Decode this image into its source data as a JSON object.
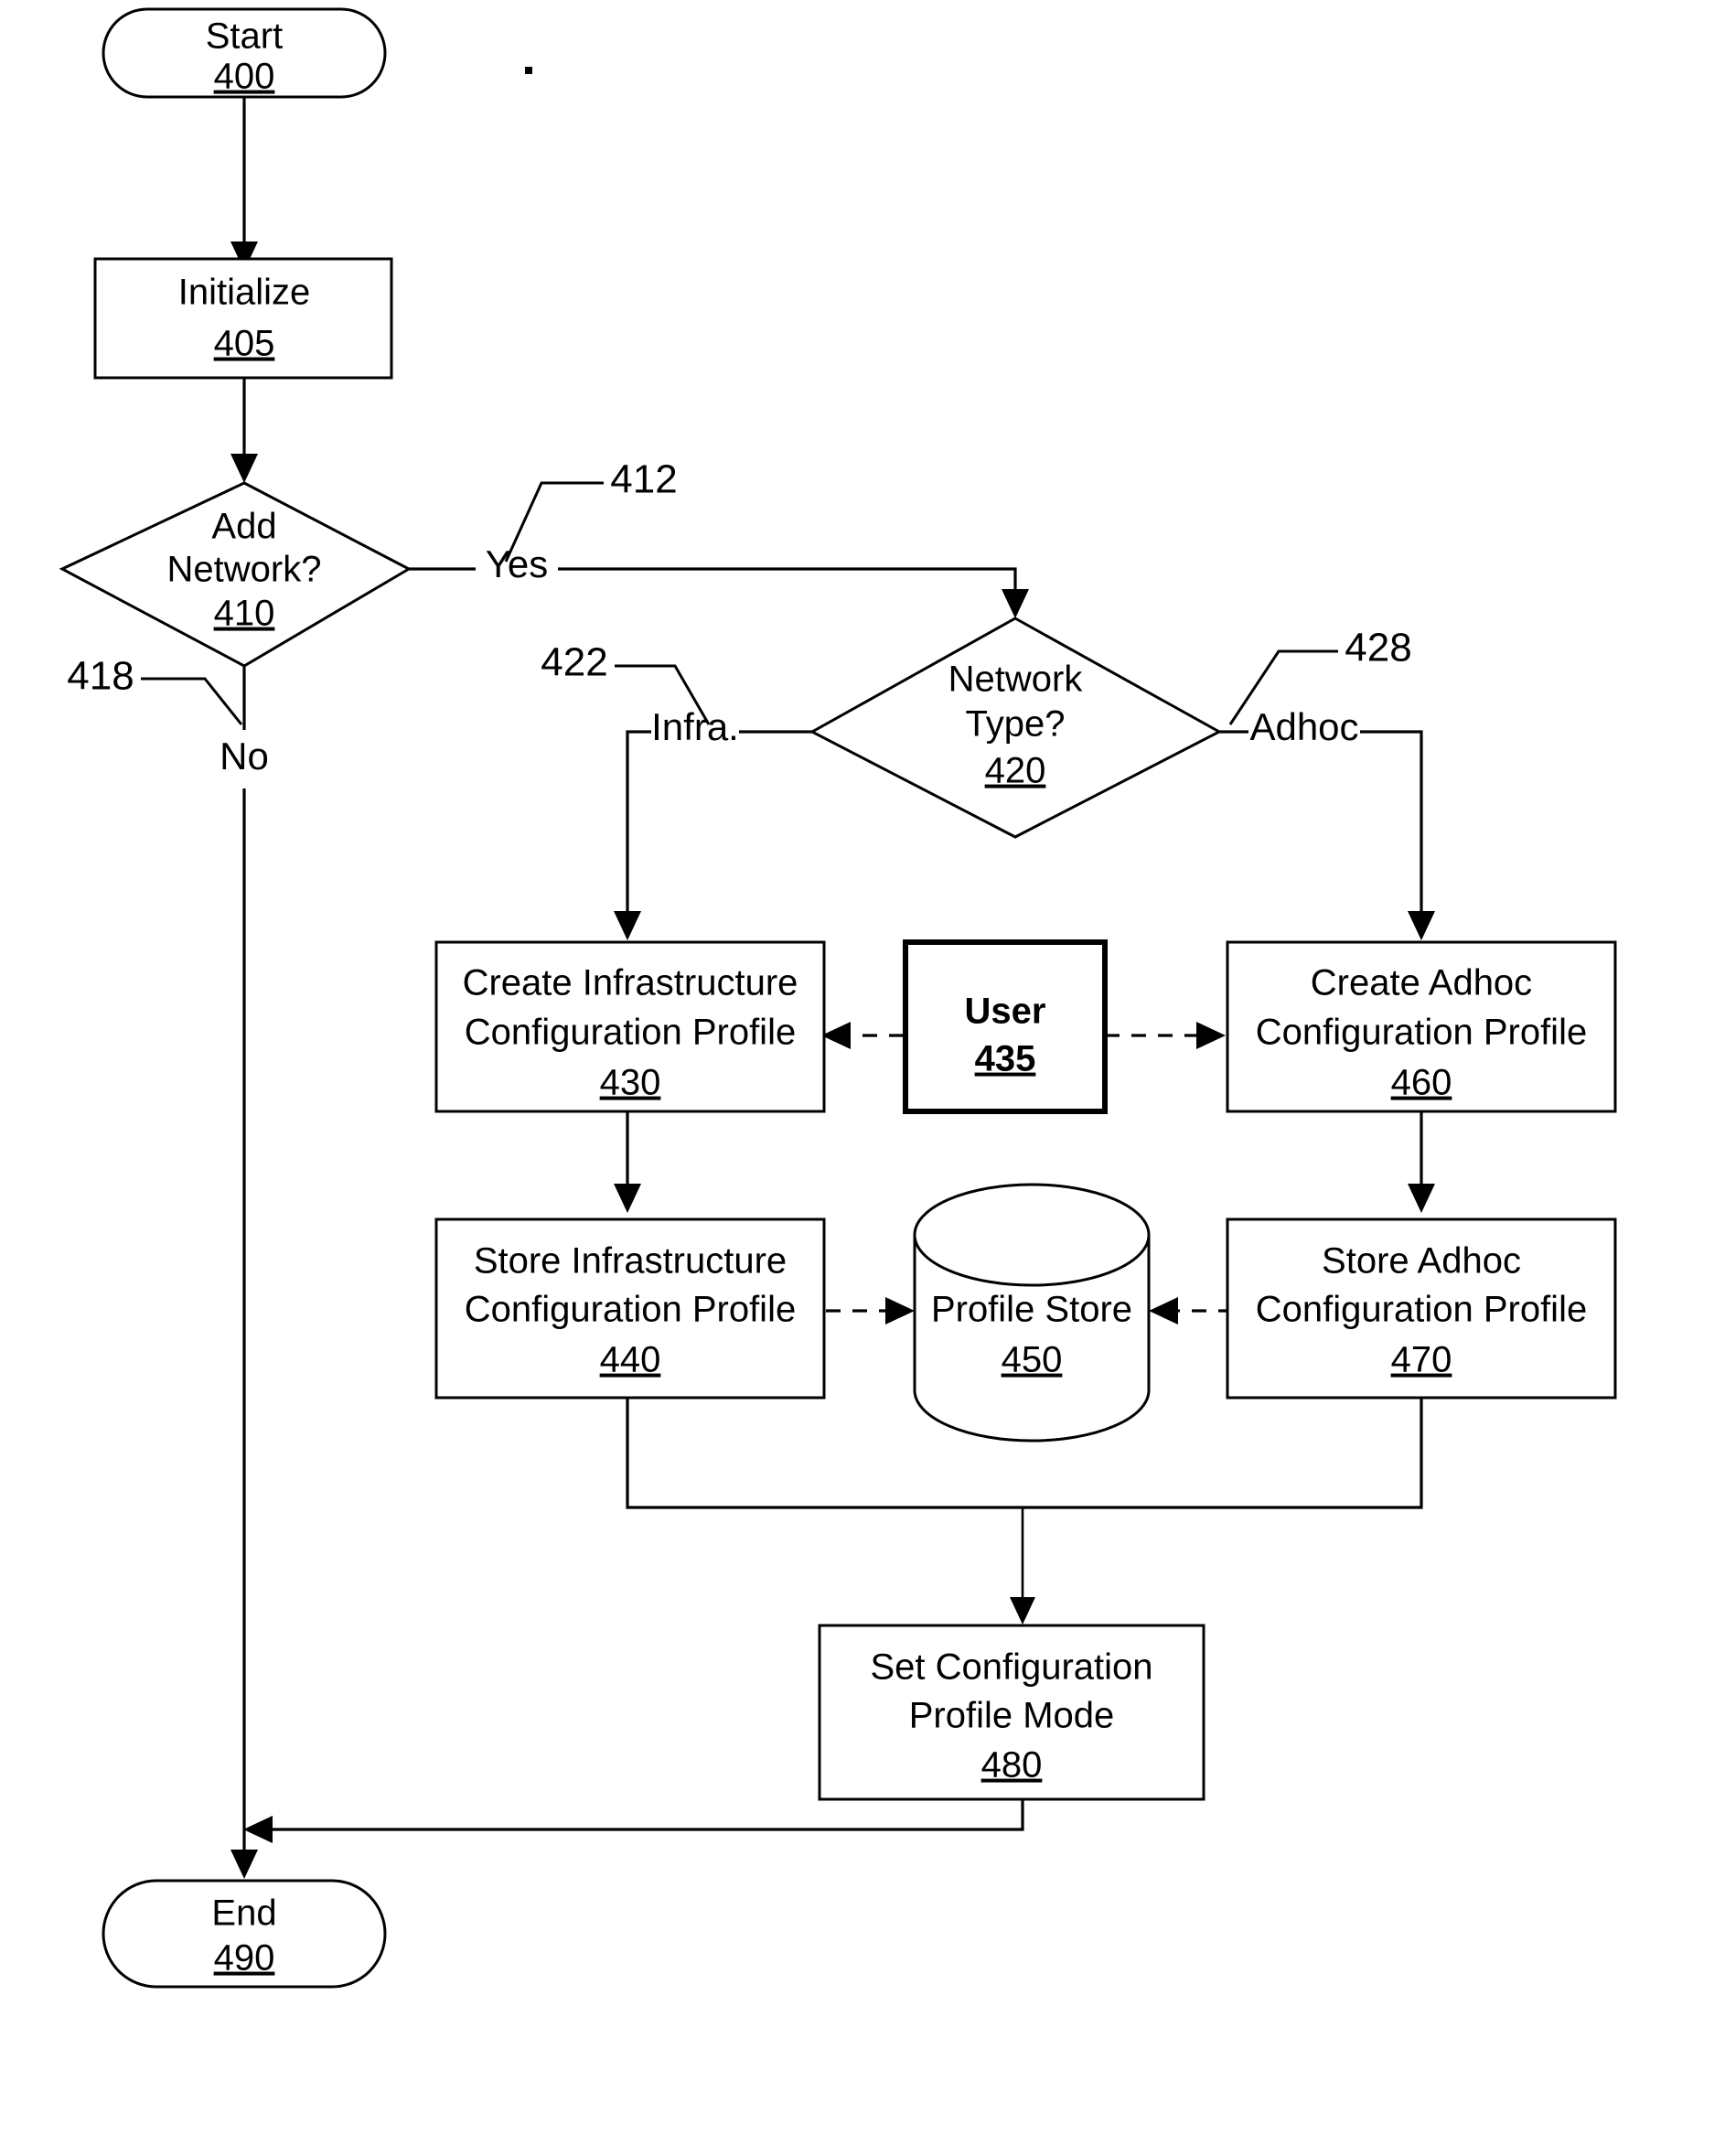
{
  "figure": {
    "type": "flowchart",
    "title": "Network configuration profile creation flowchart",
    "orientation": "top-to-bottom"
  },
  "nodes": {
    "start": {
      "label": "Start",
      "ref": "400",
      "shape": "terminator"
    },
    "initialize": {
      "label": "Initialize",
      "ref": "405",
      "shape": "process"
    },
    "add_network": {
      "line1": "Add",
      "line2": "Network?",
      "ref": "410",
      "shape": "decision"
    },
    "network_type": {
      "line1": "Network",
      "line2": "Type?",
      "ref": "420",
      "shape": "decision"
    },
    "create_infra": {
      "line1": "Create Infrastructure",
      "line2": "Configuration Profile",
      "ref": "430",
      "shape": "process"
    },
    "user": {
      "label": "User",
      "ref": "435",
      "shape": "process-bold"
    },
    "create_adhoc": {
      "line1": "Create Adhoc",
      "line2": "Configuration Profile",
      "ref": "460",
      "shape": "process"
    },
    "store_infra": {
      "line1": "Store Infrastructure",
      "line2": "Configuration Profile",
      "ref": "440",
      "shape": "process"
    },
    "profile_store": {
      "label": "Profile Store",
      "ref": "450",
      "shape": "datastore"
    },
    "store_adhoc": {
      "line1": "Store Adhoc",
      "line2": "Configuration Profile",
      "ref": "470",
      "shape": "process"
    },
    "set_mode": {
      "line1": "Set Configuration",
      "line2": "Profile Mode",
      "ref": "480",
      "shape": "process"
    },
    "end": {
      "label": "End",
      "ref": "490",
      "shape": "terminator"
    }
  },
  "edge_labels": {
    "yes": "Yes",
    "no": "No",
    "infra": "Infra.",
    "adhoc": "Adhoc"
  },
  "callouts": {
    "c412": "412",
    "c418": "418",
    "c422": "422",
    "c428": "428"
  },
  "colors": {
    "ink": "#000000",
    "paper": "#ffffff"
  }
}
